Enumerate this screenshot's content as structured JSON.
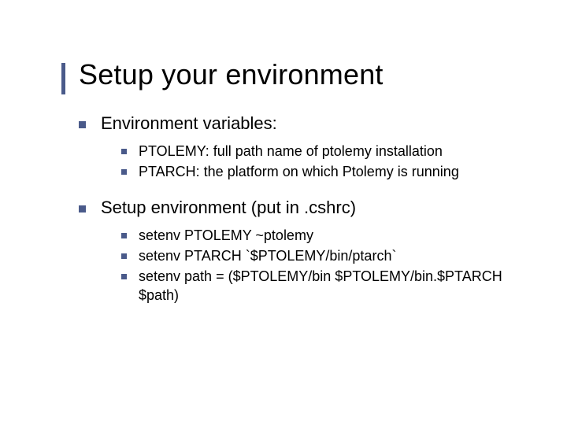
{
  "title": "Setup your environment",
  "items": [
    {
      "label": "Environment variables:",
      "sub": [
        "PTOLEMY: full path name of ptolemy installation",
        "PTARCH: the platform on which Ptolemy is running"
      ]
    },
    {
      "label": "Setup environment (put in .cshrc)",
      "sub": [
        "setenv PTOLEMY ~ptolemy",
        "setenv PTARCH `$PTOLEMY/bin/ptarch`",
        "setenv path = ($PTOLEMY/bin $PTOLEMY/bin.$PTARCH $path)"
      ]
    }
  ]
}
